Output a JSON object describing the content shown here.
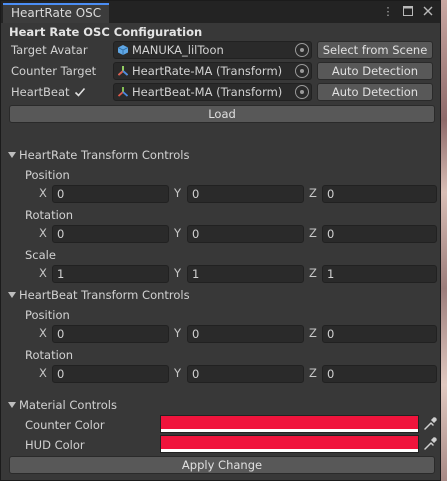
{
  "window": {
    "tab_title": "HeartRate OSC",
    "title_icons": [
      "menu-dots-icon",
      "maximize-icon",
      "close-icon"
    ]
  },
  "config": {
    "header": "Heart Rate OSC Configuration",
    "target_avatar": {
      "label": "Target Avatar",
      "value": "MANUKA_lilToon",
      "icon": "prefab-cube-icon",
      "button": "Select from Scene"
    },
    "counter_target": {
      "label": "Counter Target",
      "value": "HeartRate-MA (Transform)",
      "icon": "transform-icon",
      "button": "Auto Detection"
    },
    "heartbeat": {
      "label": "HeartBeat",
      "checked": true,
      "value": "HeartBeat-MA (Transform)",
      "icon": "transform-icon",
      "button": "Auto Detection"
    },
    "load_button": "Load"
  },
  "heartrate_controls": {
    "header": "HeartRate Transform Controls",
    "position": {
      "label": "Position",
      "x": "0",
      "y": "0",
      "z": "0"
    },
    "rotation": {
      "label": "Rotation",
      "x": "0",
      "y": "0",
      "z": "0"
    },
    "scale": {
      "label": "Scale",
      "x": "1",
      "y": "1",
      "z": "1"
    }
  },
  "heartbeat_controls": {
    "header": "HeartBeat Transform Controls",
    "position": {
      "label": "Position",
      "x": "0",
      "y": "0",
      "z": "0"
    },
    "rotation": {
      "label": "Rotation",
      "x": "0",
      "y": "0",
      "z": "0"
    }
  },
  "axes": {
    "x": "X",
    "y": "Y",
    "z": "Z"
  },
  "material": {
    "header": "Material Controls",
    "counter_color": {
      "label": "Counter Color",
      "color": "#f0143c"
    },
    "hud_color": {
      "label": "HUD Color",
      "color": "#f0143c"
    },
    "apply_button": "Apply Change"
  },
  "colors": {
    "accent": "#4b8ef5",
    "panel": "#383838",
    "field": "#2a2a2a",
    "button": "#585858"
  }
}
